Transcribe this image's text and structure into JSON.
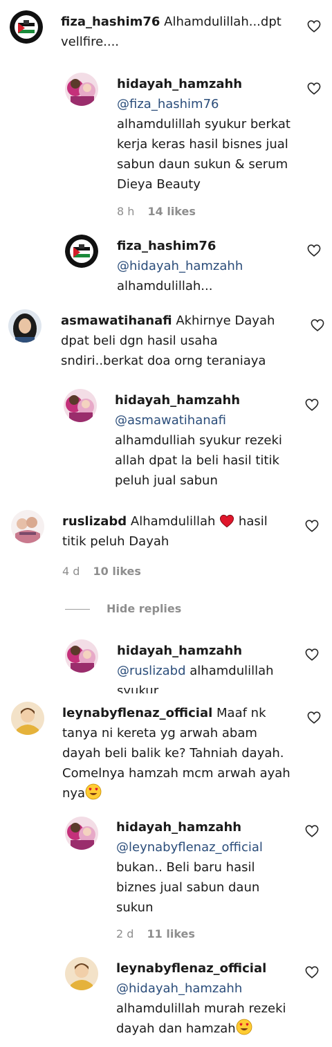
{
  "comments": [
    {
      "username": "fiza_hashim76",
      "text": "Alhamdulillah...dpt vellfire...."
    },
    {
      "username": "hidayah_hamzahh",
      "mention": "@fiza_hashim76",
      "text": "alhamdulillah syukur berkat kerja keras hasil bisnes jual sabun daun sukun & serum Dieya Beauty",
      "time": "8 h",
      "likes": "14 likes"
    },
    {
      "username": "fiza_hashim76",
      "mention": "@hidayah_hamzahh",
      "text": "alhamdulillah..."
    },
    {
      "username": "asmawatihanafi",
      "text": "Akhirnye Dayah dpat beli dgn hasil usaha sndiri..berkat doa orng teraniaya"
    },
    {
      "username": "hidayah_hamzahh",
      "mention": "@asmawatihanafi",
      "text": "alhamdulliah syukur rezeki allah dpat la beli hasil titik peluh jual sabun"
    },
    {
      "username": "ruslizabd",
      "text_before": "Alhamdulillah",
      "text_after": "hasil titik peluh Dayah",
      "time": "4 d",
      "likes": "10 likes"
    },
    {
      "username": "hidayah_hamzahh",
      "mention": "@ruslizabd",
      "text": "alhamdulillah syukur"
    },
    {
      "username": "leynabyflenaz_official",
      "text": "Maaf nk tanya ni kereta yg arwah abam dayah beli balik ke? Tahniah dayah. Comelnya hamzah mcm arwah ayah nya"
    },
    {
      "username": "hidayah_hamzahh",
      "mention": "@leynabyflenaz_official",
      "text": "bukan.. Beli baru hasil biznes jual sabun daun sukun",
      "time": "2 d",
      "likes": "11 likes"
    },
    {
      "username": "leynabyflenaz_official",
      "mention": "@hidayah_hamzahh",
      "text": "alhamdulillah murah rezeki dayah dan hamzah"
    }
  ],
  "hide_replies_label": "Hide replies",
  "avatar_badge_text": "FREE PALESTINE",
  "colors": {
    "mention": "#2b4d7a",
    "meta": "#8e8e8e",
    "heart_red": "#e0162b",
    "text": "#1a1a1a"
  }
}
